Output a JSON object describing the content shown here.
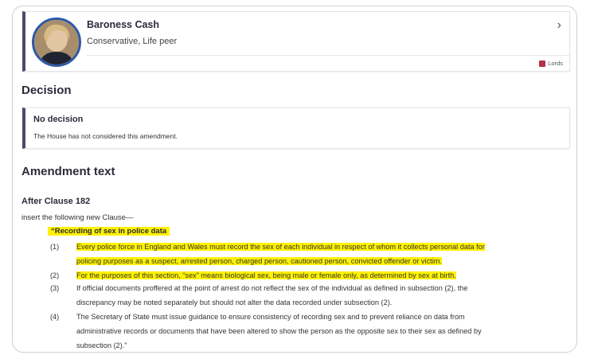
{
  "member": {
    "name": "Baroness Cash",
    "party": "Conservative, Life peer",
    "house_tag": "Lords",
    "chevron": "›"
  },
  "decision": {
    "heading": "Decision",
    "title": "No decision",
    "text": "The House has not considered this amendment."
  },
  "amendment": {
    "heading": "Amendment text",
    "after_clause": "After Clause 182",
    "insert_line": "insert the following new Clause—",
    "clause_title": "“Recording of sex in police data",
    "paragraphs": [
      {
        "num": "(1)",
        "line1": "Every police force in England and Wales must record the sex of each individual in respect of whom it collects personal data for",
        "line2": "policing purposes as a suspect, arrested person, charged person, cautioned person, convicted offender or victim."
      },
      {
        "num": "(2)",
        "line1": "For the purposes of this section, “sex” means biological sex, being male or female only, as determined by sex at birth."
      },
      {
        "num": "(3)",
        "line1": "If official documents proffered at the point of arrest do not reflect the sex of the individual as defined in subsection (2), the",
        "line2": "discrepancy may be noted separately but should not alter the data recorded under subsection (2)."
      },
      {
        "num": "(4)",
        "line1": "The Secretary of State must issue guidance to ensure consistency of recording sex and to prevent reliance on data from",
        "line2": "administrative records or documents that have been altered to show the person as the opposite sex to their sex as defined by",
        "line3": "subsection (2).”"
      }
    ]
  },
  "colors": {
    "highlight": "#fff200",
    "card_accent": "#4d4a6b",
    "avatar_ring": "#2d5aa5",
    "lords_icon": "#b5304a"
  }
}
